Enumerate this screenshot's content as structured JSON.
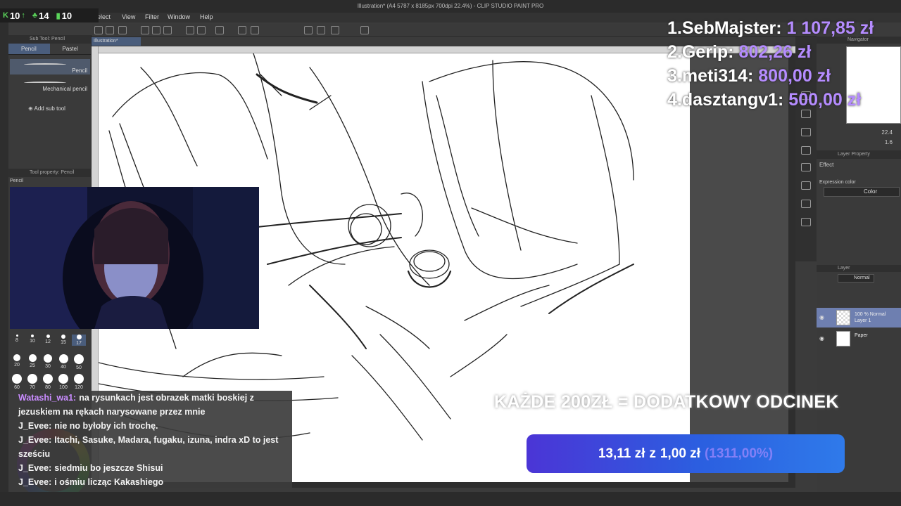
{
  "window": {
    "title": "Illustration* (A4 5787 x 8185px 700dpi 22.4%) - CLIP STUDIO PAINT PRO"
  },
  "menu": {
    "items": [
      "elect",
      "View",
      "Filter",
      "Window",
      "Help"
    ]
  },
  "stream_stats": {
    "followers": "10",
    "likes": "14",
    "subs": "10"
  },
  "subtool": {
    "title": "Sub Tool: Pencil",
    "tabs": [
      "Pencil",
      "Pastel"
    ],
    "brushes": [
      "Pencil",
      "Mechanical pencil"
    ],
    "add_sub_tool": "Add sub tool",
    "tool_property": "Tool property: Pencil",
    "tool_property_tab": "Pencil"
  },
  "canvas": {
    "tab": "Illustration*"
  },
  "brush_sizes": {
    "row1": [
      "8",
      "10",
      "12",
      "15",
      "17"
    ],
    "row2": [
      "20",
      "25",
      "30",
      "40",
      "50"
    ],
    "row3": [
      "60",
      "70",
      "80",
      "100",
      "120"
    ]
  },
  "navigator": {
    "title": "Navigator",
    "zoom": "22.4",
    "rotation": "1.6"
  },
  "layer_property": {
    "title": "Layer Property",
    "effect": "Effect",
    "expression_color_label": "Expression color",
    "expression_color_value": "Color"
  },
  "layers": {
    "title": "Layer",
    "blend_mode": "Normal",
    "items": [
      {
        "mode": "100 % Normal",
        "name": "Layer 1"
      },
      {
        "mode": "",
        "name": "Paper"
      }
    ]
  },
  "leaderboard": [
    {
      "rank": "1.",
      "name": "SebMajster:",
      "amount": "1 107,85 zł"
    },
    {
      "rank": "2.",
      "name": "Gerip:",
      "amount": "802,26 zł"
    },
    {
      "rank": "3.",
      "name": "meti314:",
      "amount": "800,00 zł"
    },
    {
      "rank": "4.",
      "name": "dasztangv1:",
      "amount": "500,00 zł"
    }
  ],
  "promo_text": "KAŻDE 200ZŁ = DODATKOWY ODCINEK",
  "goal": {
    "current": "13,11 zł",
    "separator": "z",
    "target": "1,00 zł",
    "percent": "(1311,00%)"
  },
  "chat": [
    {
      "user": "Watashi_wa1:",
      "color": "#c98cff",
      "message": "na rysunkach jest obrazek matki boskiej z jezuskiem na rękach narysowane przez mnie"
    },
    {
      "user": "J_Evee:",
      "color": "#ffffff",
      "message": "nie no byłoby ich trochę."
    },
    {
      "user": "J_Evee:",
      "color": "#ffffff",
      "message": "Itachi, Sasuke, Madara, fugaku, izuna, indra xD to jest sześciu"
    },
    {
      "user": "J_Evee:",
      "color": "#ffffff",
      "message": "siedmiu bo jeszcze Shisui"
    },
    {
      "user": "J_Evee:",
      "color": "#ffffff",
      "message": "i ośmiu licząc Kakashiego"
    }
  ]
}
